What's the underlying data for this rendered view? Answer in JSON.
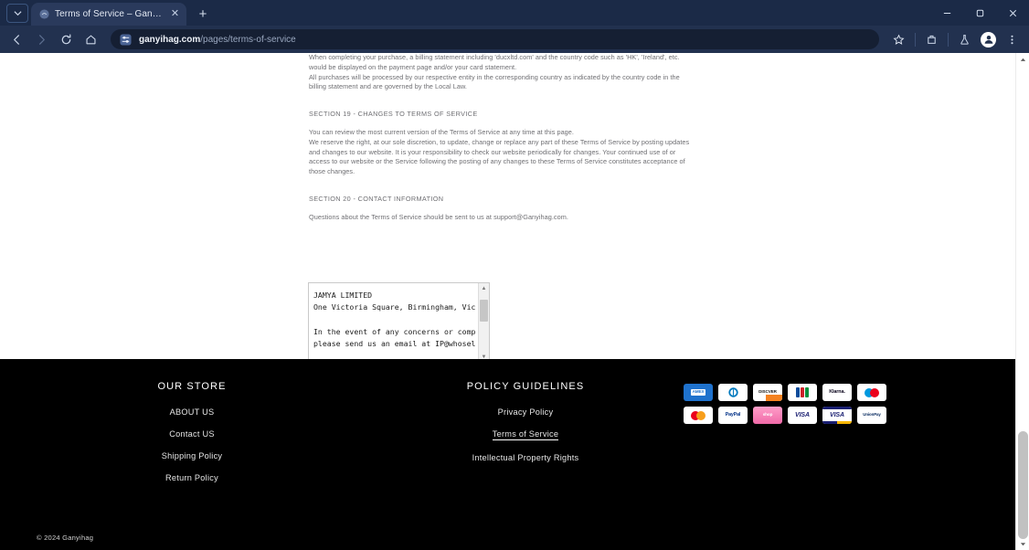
{
  "browser": {
    "tab": {
      "title": "Terms of Service – Ganyihag",
      "favicon_name": "site-favicon",
      "close_glyph": "✕"
    },
    "new_tab_glyph": "+",
    "tab_list_glyph": "⌄",
    "window_controls": {
      "minimize": "—",
      "maximize": "▫",
      "close": "✕"
    },
    "toolbar": {
      "back_glyph": "←",
      "forward_glyph": "→",
      "reload_glyph": "⟳",
      "home_glyph": "⌂",
      "url_prefix": "ganyihag.com",
      "url_suffix": "/pages/terms-of-service",
      "site_settings_glyph": "⚏",
      "bookmark_glyph": "☆",
      "extensions_glyph": "⬓",
      "labs_glyph": "⚗",
      "profile_glyph": "●",
      "menu_glyph": "⋮"
    }
  },
  "page": {
    "article": {
      "paragraph_1": [
        "When completing your purchase, a billing statement including 'ducxltd.com' and the country code such as 'HK', 'Ireland', etc.",
        "would be displayed on the payment page and/or your card statement."
      ],
      "paragraph_2": [
        "All purchases will be processed by our respective entity in the corresponding country as indicated by the country code in the",
        "billing statement and are governed by the Local Law."
      ],
      "section_19_heading": "SECTION 19 - CHANGES TO TERMS OF SERVICE",
      "section_19_body": [
        "You can review the most current version of the Terms of Service at any time at this page.",
        "We reserve the right, at our sole discretion, to update, change or replace any part of these Terms of Service by posting updates",
        "and changes to our website. It is your responsibility to check our website periodically for changes. Your continued use of or",
        "access to our website or the Service following the posting of any changes to these Terms of Service constitutes acceptance of",
        "those changes."
      ],
      "section_20_heading": "SECTION 20 - CONTACT INFORMATION",
      "section_20_body": "Questions about the Terms of Service should be sent to us at support@Ganyihag.com."
    },
    "embed": {
      "text": "JAMYA LIMITED\nOne Victoria Square, Birmingham, Vic\n\nIn the event of any concerns or comp\nplease send us an email at IP@whosel",
      "v_up_glyph": "▲",
      "v_down_glyph": "▼",
      "h_left_glyph": "◄",
      "h_right_glyph": "►"
    },
    "footer": {
      "columns": [
        {
          "heading": "OUR STORE",
          "links": [
            {
              "label": "ABOUT US",
              "active": false
            },
            {
              "label": "Contact US",
              "active": false
            },
            {
              "label": "Shipping Policy",
              "active": false
            },
            {
              "label": "Return Policy",
              "active": false
            }
          ]
        },
        {
          "heading": "POLICY GUIDELINES",
          "links": [
            {
              "label": "Privacy Policy",
              "active": false
            },
            {
              "label": "Terms of Service",
              "active": true
            },
            {
              "label": "Intellectual Property Rights",
              "active": false
            }
          ]
        }
      ],
      "payment_methods": [
        {
          "name": "american-express",
          "label": "AMEX"
        },
        {
          "name": "diners-club",
          "label": "Diners Club"
        },
        {
          "name": "discover",
          "label": "DISCVER"
        },
        {
          "name": "jcb",
          "label": "JCB"
        },
        {
          "name": "klarna",
          "label": "Klarna."
        },
        {
          "name": "maestro",
          "label": "maestro"
        },
        {
          "name": "mastercard",
          "label": "mastercard"
        },
        {
          "name": "paypal",
          "label": "PayPal"
        },
        {
          "name": "shop-pay",
          "label": "shop"
        },
        {
          "name": "visa",
          "label": "VISA"
        },
        {
          "name": "visa-electron",
          "label": "VISA"
        },
        {
          "name": "union-pay",
          "label": "UnionPay"
        }
      ],
      "copyright": "© 2024 Ganyihag"
    }
  }
}
